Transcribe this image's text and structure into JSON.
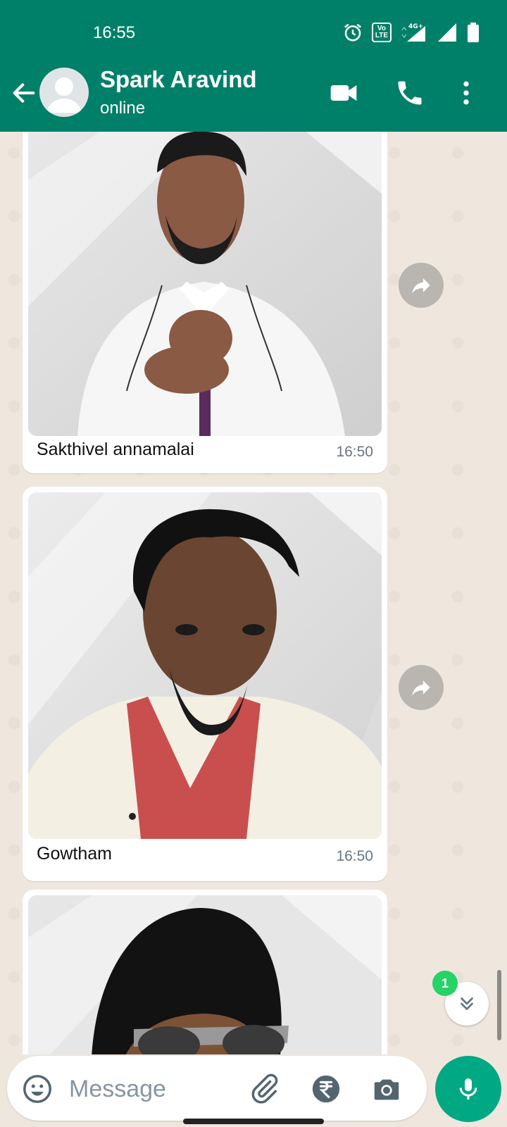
{
  "status_bar": {
    "time": "16:55",
    "volte": "Vo LTE 1",
    "network": "4G+"
  },
  "header": {
    "contact_name": "Spark Aravind",
    "contact_status": "online",
    "icons": [
      "back-arrow-icon",
      "avatar",
      "video-call-icon",
      "voice-call-icon",
      "more-options-icon"
    ],
    "accent_color": "#008069"
  },
  "messages": [
    {
      "caption": "Sakthivel annamalai",
      "time": "16:50"
    },
    {
      "caption": "Gowtham",
      "time": "16:50"
    },
    {
      "caption": "",
      "time": ""
    }
  ],
  "scroll_down": {
    "unread_count": "1"
  },
  "input": {
    "placeholder": "Message",
    "icons": [
      "emoji-icon",
      "attach-icon",
      "rupee-payment-icon",
      "camera-icon",
      "mic-icon"
    ]
  },
  "colors": {
    "chat_bg": "#efe7de",
    "send_button": "#00a884",
    "badge": "#25d366"
  }
}
